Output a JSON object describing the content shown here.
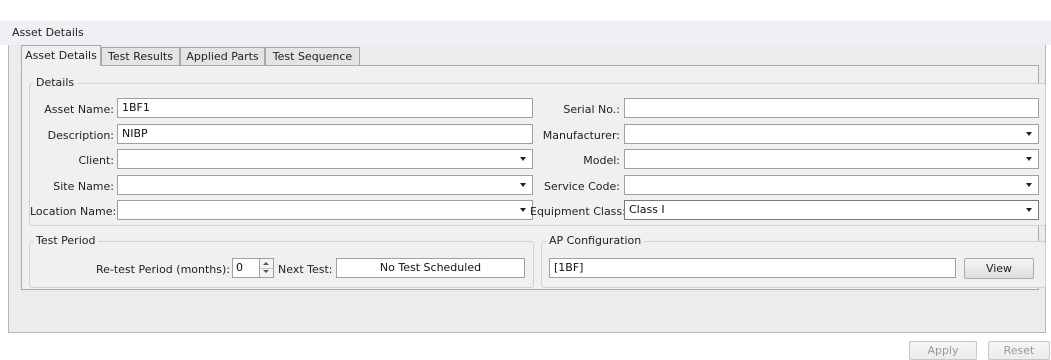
{
  "window": {
    "title": "Asset Details"
  },
  "tabs": [
    "Asset Details",
    "Test Results",
    "Applied Parts",
    "Test Sequence"
  ],
  "details": {
    "group_label": "Details",
    "asset_name": {
      "label": "Asset Name:",
      "value": "1BF1"
    },
    "description": {
      "label": "Description:",
      "value": "NIBP"
    },
    "client": {
      "label": "Client:",
      "value": ""
    },
    "site_name": {
      "label": "Site Name:",
      "value": ""
    },
    "location_name": {
      "label": "Location Name:",
      "value": ""
    },
    "serial_no": {
      "label": "Serial No.:",
      "value": ""
    },
    "manufacturer": {
      "label": "Manufacturer:",
      "value": ""
    },
    "model": {
      "label": "Model:",
      "value": ""
    },
    "service_code": {
      "label": "Service Code:",
      "value": ""
    },
    "equipment_class": {
      "label": "Equipment Class:",
      "value": "Class I"
    }
  },
  "test_period": {
    "group_label": "Test Period",
    "retest_label": "Re-test Period (months):",
    "retest_value": "0",
    "next_test_label": "Next Test:",
    "next_test_value": "No Test Scheduled"
  },
  "ap_configuration": {
    "group_label": "AP Configuration",
    "value": "[1BF]",
    "view_label": "View"
  },
  "footer": {
    "apply_label": "Apply",
    "reset_label": "Reset"
  }
}
